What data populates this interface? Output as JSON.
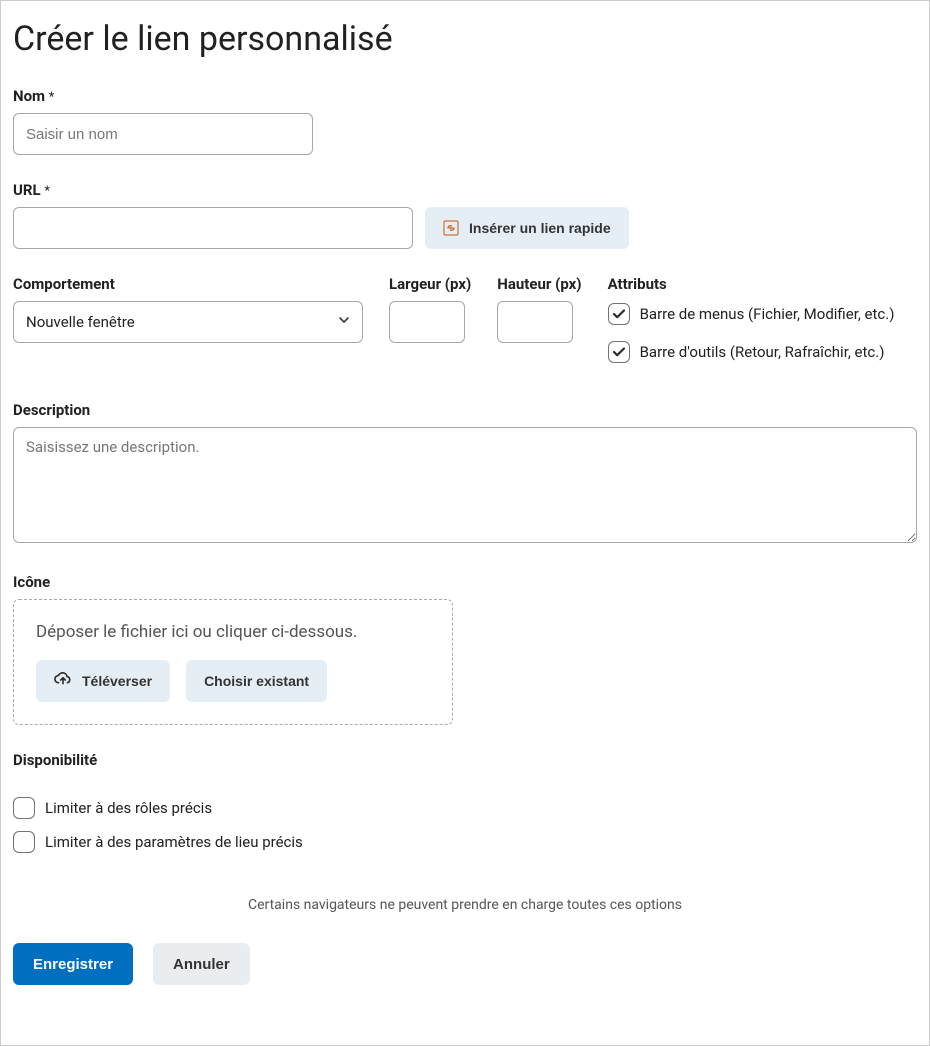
{
  "page": {
    "title": "Créer le lien personnalisé"
  },
  "name": {
    "label": "Nom",
    "required_mark": "*",
    "placeholder": "Saisir un nom",
    "value": ""
  },
  "url": {
    "label": "URL",
    "required_mark": "*",
    "value": "",
    "quicklink_label": "Insérer un lien rapide"
  },
  "behavior": {
    "label": "Comportement",
    "selected": "Nouvelle fenêtre"
  },
  "width": {
    "label": "Largeur (px)",
    "value": ""
  },
  "height": {
    "label": "Hauteur (px)",
    "value": ""
  },
  "attributes": {
    "label": "Attributs",
    "items": [
      {
        "label": "Barre de menus (Fichier, Modifier, etc.)",
        "checked": true
      },
      {
        "label": "Barre d'outils (Retour, Rafraîchir, etc.)",
        "checked": true
      }
    ]
  },
  "description": {
    "label": "Description",
    "placeholder": "Saisissez une description.",
    "value": ""
  },
  "icon": {
    "label": "Icône",
    "drop_text": "Déposer le fichier ici ou cliquer ci-dessous.",
    "upload_label": "Téléverser",
    "choose_label": "Choisir existant"
  },
  "availability": {
    "label": "Disponibilité",
    "items": [
      {
        "label": "Limiter à des rôles précis",
        "checked": false
      },
      {
        "label": "Limiter à des paramètres de lieu précis",
        "checked": false
      }
    ]
  },
  "note": "Certains navigateurs ne peuvent prendre en charge toutes ces options",
  "actions": {
    "save": "Enregistrer",
    "cancel": "Annuler"
  }
}
